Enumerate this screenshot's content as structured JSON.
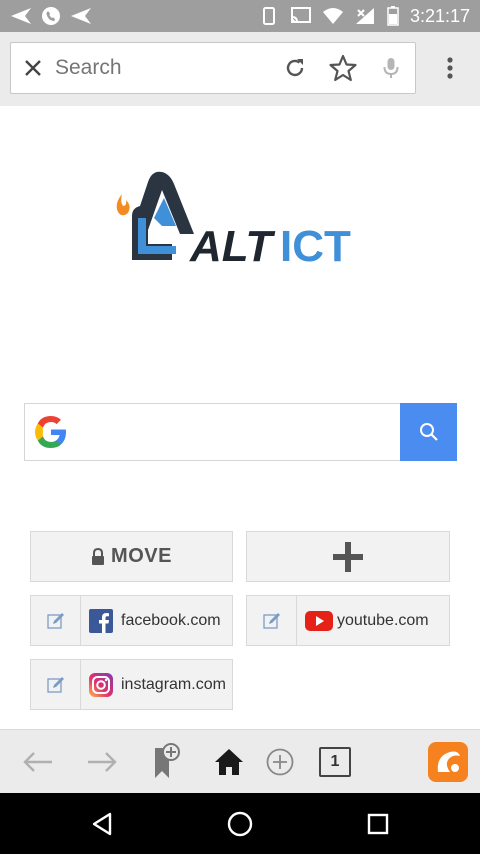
{
  "status_bar": {
    "time": "3:21:17",
    "left_icons": [
      "send-icon",
      "whatsapp-icon",
      "send-icon"
    ],
    "right_icons": [
      "phone-icon",
      "cast-icon",
      "wifi-icon",
      "signal-icon",
      "battery-icon"
    ]
  },
  "url_bar": {
    "placeholder": "Search",
    "icons": [
      "close-icon",
      "reload-icon",
      "star-icon",
      "mic-icon",
      "more-vert-icon"
    ]
  },
  "logo": {
    "text_alt": "ALT",
    "text_ict": "ICT",
    "colors": {
      "dark": "#2b3542",
      "blue": "#3f8fd9",
      "flame": "#f28b22"
    }
  },
  "google_search": {
    "placeholder": "",
    "button_color": "#4b8cf0"
  },
  "speed_dial": {
    "move_label": "MOVE",
    "add_label": "+",
    "sites": [
      {
        "label": "facebook.com",
        "icon": "facebook-icon",
        "color": "#3b5998"
      },
      {
        "label": "youtube.com",
        "icon": "youtube-icon",
        "color": "#e62117"
      },
      {
        "label": "instagram.com",
        "icon": "instagram-icon",
        "color": "#c13584"
      }
    ]
  },
  "toolbar": {
    "tab_count": "1",
    "icons": [
      "back-arrow-icon",
      "forward-arrow-icon",
      "bookmark-add-icon",
      "home-icon",
      "new-tab-icon",
      "tabs-icon",
      "app-logo-icon"
    ],
    "app_logo_color": "#f5821f"
  },
  "nav_bar": {
    "icons": [
      "nav-back-icon",
      "nav-home-icon",
      "nav-recents-icon"
    ]
  }
}
